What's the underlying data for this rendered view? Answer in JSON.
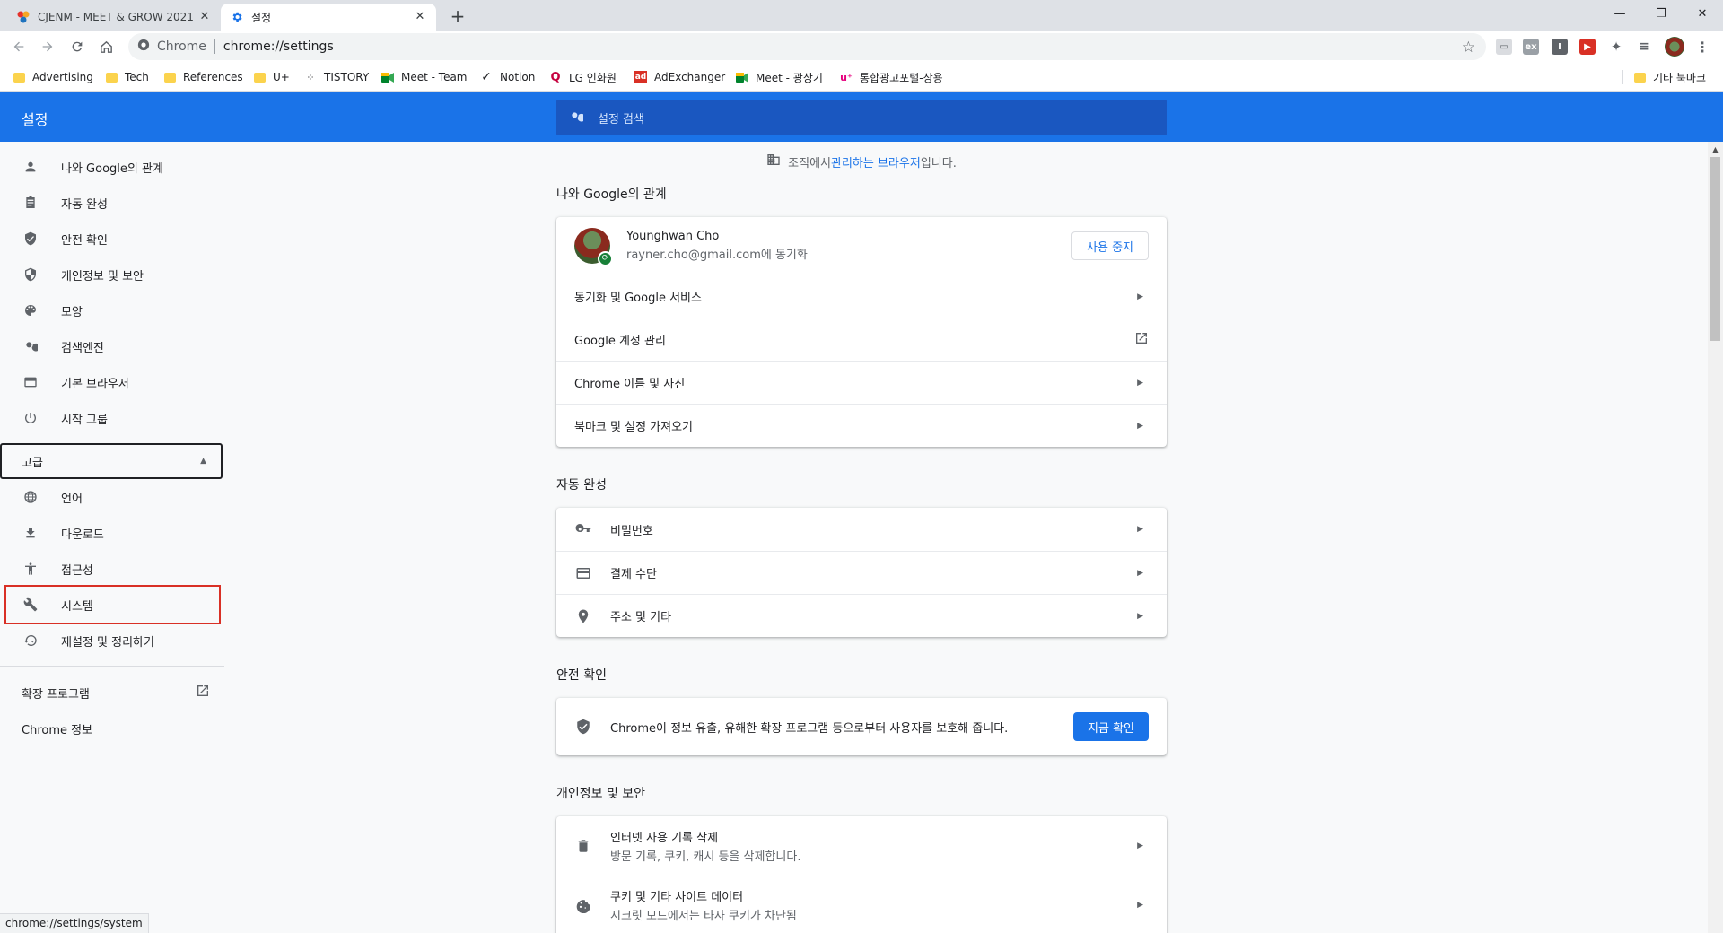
{
  "tabs": [
    {
      "title": "CJENM - MEET & GROW 2021",
      "close": "✕"
    },
    {
      "title": "설정",
      "close": "✕"
    }
  ],
  "newtab": "+",
  "window_controls": {
    "minimize": "—",
    "restore": "❐",
    "close": "✕"
  },
  "omnibox": {
    "site": "Chrome",
    "url": "chrome://settings"
  },
  "bookmarks": [
    {
      "label": "Advertising",
      "icon": "folder"
    },
    {
      "label": "Tech",
      "icon": "folder"
    },
    {
      "label": "References",
      "icon": "folder"
    },
    {
      "label": "U+",
      "icon": "folder"
    },
    {
      "label": "TISTORY",
      "icon": "tistory-icon"
    },
    {
      "label": "Meet - Team",
      "icon": "meet-icon"
    },
    {
      "label": "Notion",
      "icon": "check-icon"
    },
    {
      "label": "LG 인화원",
      "icon": "lg-icon"
    },
    {
      "label": "AdExchanger",
      "icon": "ad-icon"
    },
    {
      "label": "Meet - 광상기",
      "icon": "meet-icon"
    },
    {
      "label": "통합광고포털-상용",
      "icon": "uplus-icon"
    }
  ],
  "other_bookmarks": "기타 북마크",
  "header": {
    "title": "설정",
    "search_placeholder": "설정 검색"
  },
  "sidebar": {
    "items": [
      {
        "label": "나와 Google의 관계",
        "icon": "person-icon"
      },
      {
        "label": "자동 완성",
        "icon": "clipboard-icon"
      },
      {
        "label": "안전 확인",
        "icon": "shield-check-icon"
      },
      {
        "label": "개인정보 및 보안",
        "icon": "shield-icon"
      },
      {
        "label": "모양",
        "icon": "palette-icon"
      },
      {
        "label": "검색엔진",
        "icon": "search-icon"
      },
      {
        "label": "기본 브라우저",
        "icon": "browser-icon"
      },
      {
        "label": "시작 그룹",
        "icon": "power-icon"
      }
    ],
    "advanced": "고급",
    "advanced_items": [
      {
        "label": "언어",
        "icon": "globe-icon"
      },
      {
        "label": "다운로드",
        "icon": "download-icon"
      },
      {
        "label": "접근성",
        "icon": "accessibility-icon"
      },
      {
        "label": "시스템",
        "icon": "wrench-icon"
      },
      {
        "label": "재설정 및 정리하기",
        "icon": "history-icon"
      }
    ],
    "extensions": "확장 프로그램",
    "about": "Chrome 정보"
  },
  "main": {
    "managed_prefix": "조직에서 ",
    "managed_link": "관리하는 브라우저",
    "managed_suffix": "입니다.",
    "you_google": {
      "title": "나와 Google의 관계",
      "name": "Younghwan Cho",
      "email": "rayner.cho@gmail.com에 동기화",
      "turn_off": "사용 중지",
      "rows": [
        "동기화 및 Google 서비스",
        "Google 계정 관리",
        "Chrome 이름 및 사진",
        "북마크 및 설정 가져오기"
      ]
    },
    "autofill": {
      "title": "자동 완성",
      "rows": [
        "비밀번호",
        "결제 수단",
        "주소 및 기타"
      ]
    },
    "safety": {
      "title": "안전 확인",
      "text": "Chrome이 정보 유출, 유해한 확장 프로그램 등으로부터 사용자를 보호해 줍니다.",
      "button": "지금 확인"
    },
    "privacy": {
      "title": "개인정보 및 보안",
      "rows": [
        {
          "label": "인터넷 사용 기록 삭제",
          "sub": "방문 기록, 쿠키, 캐시 등을 삭제합니다."
        },
        {
          "label": "쿠키 및 기타 사이트 데이터",
          "sub": "시크릿 모드에서는 타사 쿠키가 차단됨"
        }
      ]
    }
  },
  "status_url": "chrome://settings/system",
  "colors": {
    "accent": "#1a73e8",
    "highlight": "#d93025"
  }
}
